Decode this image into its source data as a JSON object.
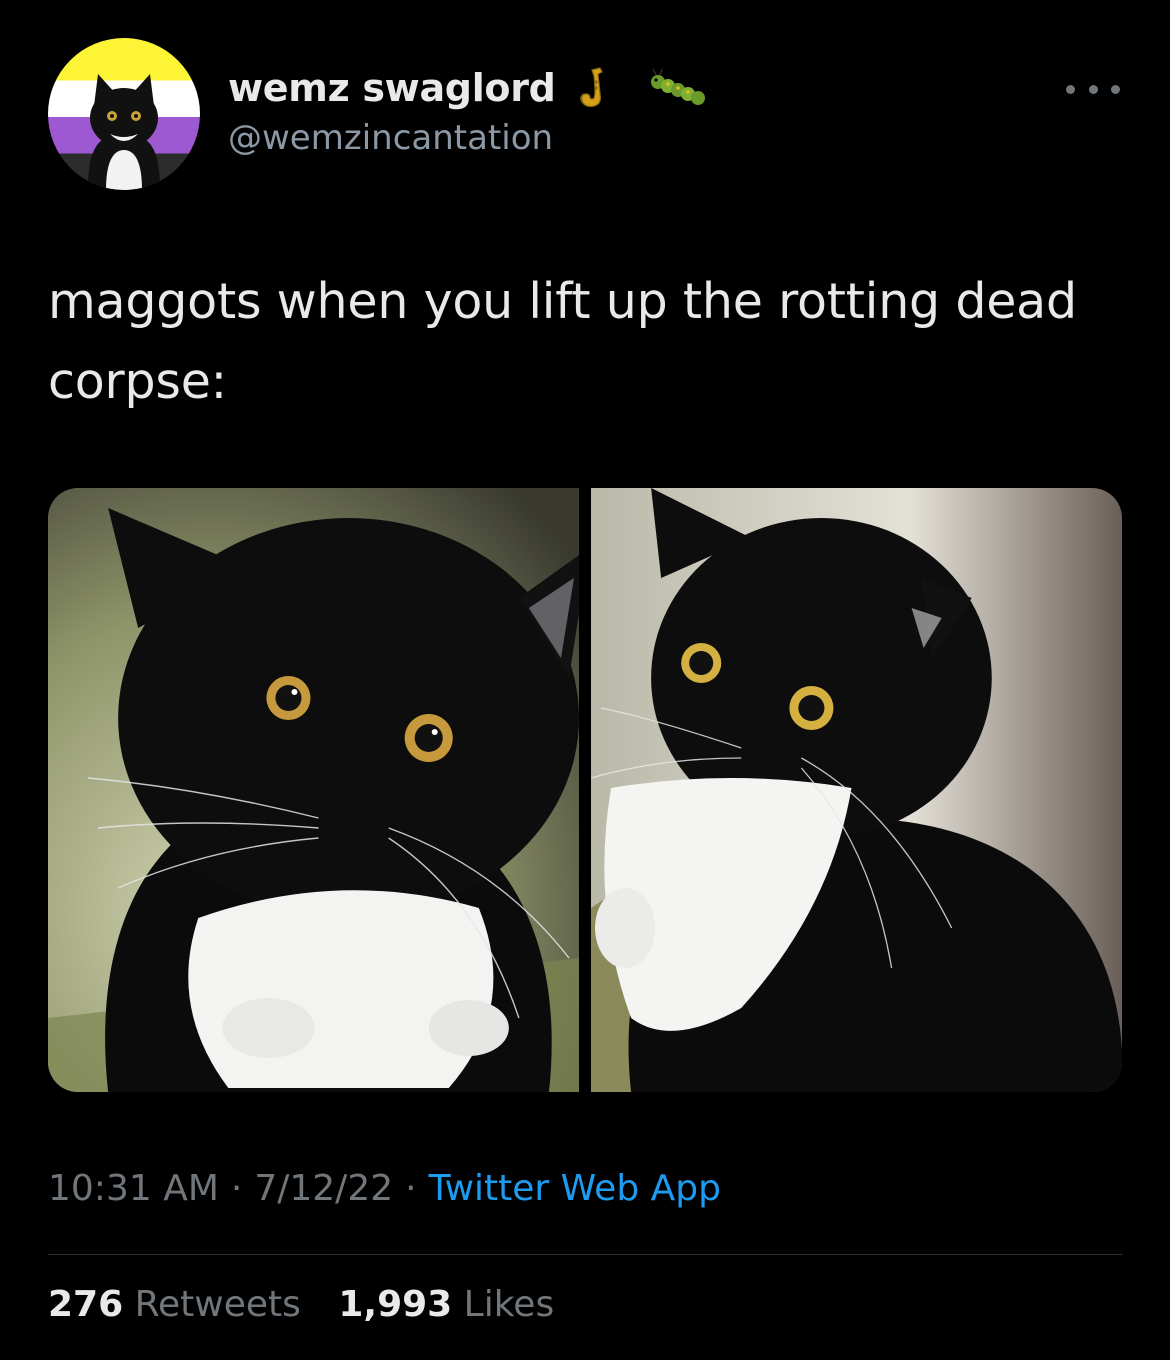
{
  "user": {
    "display_name": "wemz swaglord",
    "handle": "@wemzincantation",
    "emojis": [
      "saxophone-icon",
      "caterpillar-icon"
    ]
  },
  "tweet": {
    "text": "maggots when you lift up the rotting dead corpse:",
    "media": [
      {
        "name": "cat-photo-left",
        "description_icon": "tuxedo-cat-photo"
      },
      {
        "name": "cat-photo-right",
        "description_icon": "tuxedo-cat-photo"
      }
    ]
  },
  "meta": {
    "time": "10:31 AM",
    "separator": "·",
    "date": "7/12/22",
    "source": "Twitter Web App"
  },
  "stats": {
    "retweets_count": "276",
    "retweets_label": "Retweets",
    "likes_count": "1,993",
    "likes_label": "Likes"
  },
  "colors": {
    "background": "#000000",
    "text_primary": "#e7e9ea",
    "text_secondary": "#71767b",
    "link": "#1d9bf0",
    "divider": "#2f3336"
  }
}
